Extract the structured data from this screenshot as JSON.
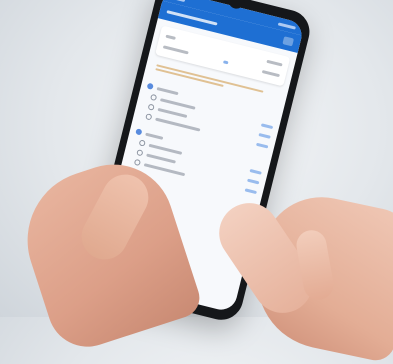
{
  "colors": {
    "accent": "#1e6fd3",
    "background": "#e3e7eb",
    "screen": "#f7f9fc",
    "skin": "#e3ad95"
  },
  "icons": [
    "app-bar-action-icon",
    "section-icon",
    "radio-icon"
  ]
}
